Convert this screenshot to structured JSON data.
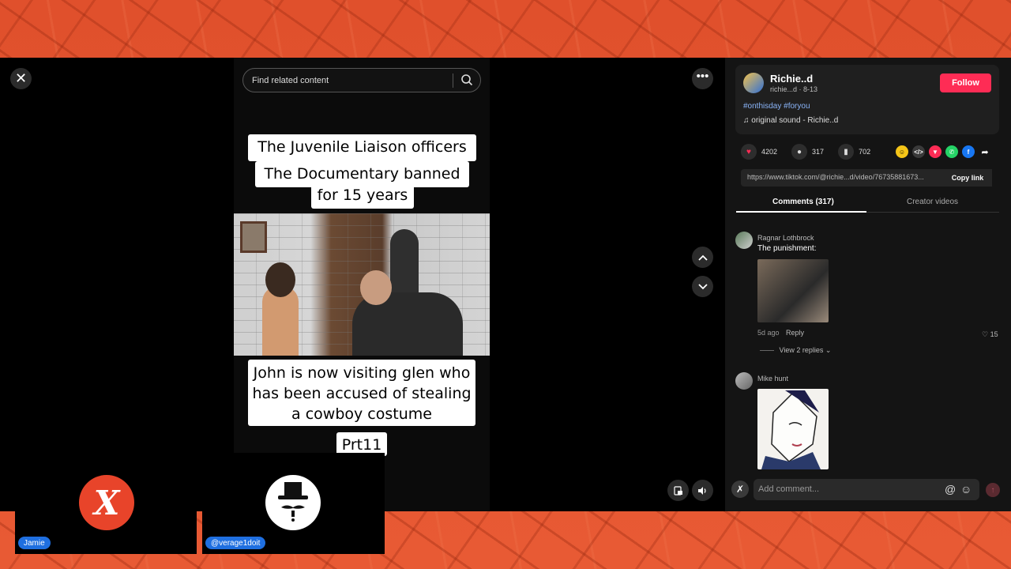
{
  "player": {
    "close_icon": "close-icon",
    "search_placeholder": "Find related content",
    "more_icon": "more-icon"
  },
  "video": {
    "captions": [
      "The Juvenile Liaison officers",
      "The Documentary banned",
      "for 15 years",
      "John is now visiting glen who has been accused of stealing a cowboy costume",
      "Prt11"
    ]
  },
  "author": {
    "name": "Richie..d",
    "sub": "richie...d · 8-13",
    "follow_label": "Follow",
    "hashtags": "#onthisday #foryou",
    "sound": "♫  original sound - Richie..d"
  },
  "stats": {
    "likes": "4202",
    "comments": "317",
    "saves": "702"
  },
  "share": {
    "link": "https://www.tiktok.com/@richie...d/video/76735881673...",
    "copy_label": "Copy link"
  },
  "tabs": {
    "comments": "Comments (317)",
    "creator": "Creator videos"
  },
  "comments": [
    {
      "user": "Ragnar Lothbrock",
      "text": "The punishment:",
      "time": "5d ago",
      "reply": "Reply",
      "likes": "15",
      "view_replies": "View 2 replies"
    },
    {
      "user": "Mike hunt"
    }
  ],
  "composer": {
    "placeholder": "Add comment...",
    "at": "@",
    "emoji": "☺",
    "send": "↑"
  },
  "cams": [
    {
      "name": "Jamie"
    },
    {
      "name": "@verage1doit"
    }
  ],
  "colors": {
    "accent": "#fe2c55",
    "background": "#e2542f",
    "tag": "#1f6fe0"
  }
}
